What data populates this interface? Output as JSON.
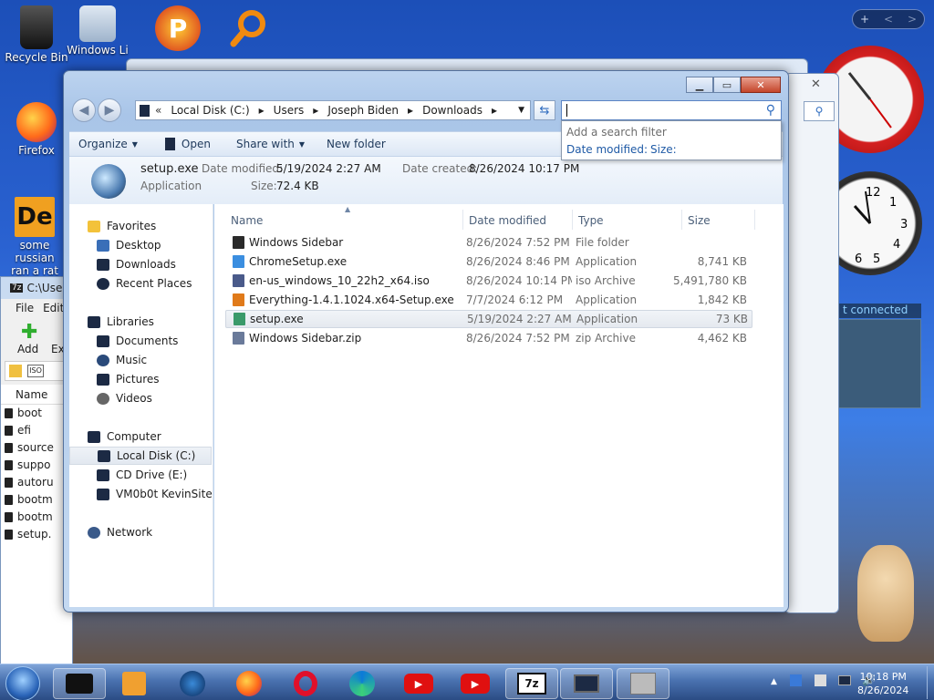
{
  "desktop": {
    "icons": [
      {
        "label": "Recycle Bin",
        "icon": "recycle-bin-icon"
      },
      {
        "label": "Windows Li",
        "icon": "windows-live-icon"
      },
      {
        "label": "Firefox",
        "icon": "firefox-icon"
      },
      {
        "label": "some russian",
        "label2": "ran a rat",
        "icon": "de-app-icon"
      }
    ],
    "gadget_buttons": [
      "+",
      "<",
      ">"
    ],
    "network_gadget_text": "t connected"
  },
  "zip_window": {
    "title": "C:\\Use",
    "menu": [
      "File",
      "Edit"
    ],
    "add_label": "Add",
    "ext_label": "Ex",
    "column_name": "Name",
    "rows": [
      "boot",
      "efi",
      "source",
      "suppo",
      "autoru",
      "bootm",
      "bootm",
      "setup."
    ]
  },
  "explorer": {
    "breadcrumb": [
      "Local Disk (C:)",
      "Users",
      "Joseph Biden",
      "Downloads"
    ],
    "search_placeholder": "",
    "search_drop": {
      "hint": "Add a search filter",
      "filters": [
        "Date modified:",
        "Size:"
      ]
    },
    "toolbar": {
      "organize": "Organize",
      "open": "Open",
      "share_with": "Share with",
      "new_folder": "New folder"
    },
    "details": {
      "name": "setup.exe",
      "type": "Application",
      "date_modified_label": "Date modified:",
      "date_modified": "5/19/2024 2:27 AM",
      "date_created_label": "Date created:",
      "date_created": "8/26/2024 10:17 PM",
      "size_label": "Size:",
      "size": "72.4 KB"
    },
    "nav": {
      "favorites": "Favorites",
      "desktop": "Desktop",
      "downloads": "Downloads",
      "recent": "Recent Places",
      "libraries": "Libraries",
      "documents": "Documents",
      "music": "Music",
      "pictures": "Pictures",
      "videos": "Videos",
      "computer": "Computer",
      "local_disk": "Local Disk (C:)",
      "cd_drive": "CD Drive (E:)",
      "vm": "VM0b0t KevinSite",
      "network": "Network"
    },
    "columns": {
      "name": "Name",
      "date": "Date modified",
      "type": "Type",
      "size": "Size"
    },
    "files": [
      {
        "name": "Windows Sidebar",
        "date": "8/26/2024 7:52 PM",
        "type": "File folder",
        "size": "",
        "icon": "folder-icon",
        "color": "#2a2a2a"
      },
      {
        "name": "ChromeSetup.exe",
        "date": "8/26/2024 8:46 PM",
        "type": "Application",
        "size": "8,741 KB",
        "icon": "chrome-icon",
        "color": "#3b8ee0"
      },
      {
        "name": "en-us_windows_10_22h2_x64.iso",
        "date": "8/26/2024 10:14 PM",
        "type": "iso Archive",
        "size": "5,491,780 KB",
        "icon": "iso-icon",
        "color": "#4a5a8a"
      },
      {
        "name": "Everything-1.4.1.1024.x64-Setup.exe",
        "date": "7/7/2024 6:12 PM",
        "type": "Application",
        "size": "1,842 KB",
        "icon": "everything-search-icon",
        "color": "#e07a1a"
      },
      {
        "name": "setup.exe",
        "date": "5/19/2024 2:27 AM",
        "type": "Application",
        "size": "73 KB",
        "icon": "setup-icon",
        "color": "#3a9a6a"
      },
      {
        "name": "Windows Sidebar.zip",
        "date": "8/26/2024 7:52 PM",
        "type": "zip Archive",
        "size": "4,462 KB",
        "icon": "zip-icon",
        "color": "#6a7a9a"
      }
    ]
  },
  "taskbar": {
    "time": "10:18 PM",
    "date": "8/26/2024",
    "apps": [
      "start-orb-icon",
      "terminal-icon",
      "media-player-icon",
      "globe-icon",
      "firefox-icon",
      "opera-icon",
      "edge-icon",
      "youtube-icon",
      "youtube-icon",
      "7zip-icon",
      "monitor-icon",
      "sidebar-icon"
    ]
  }
}
